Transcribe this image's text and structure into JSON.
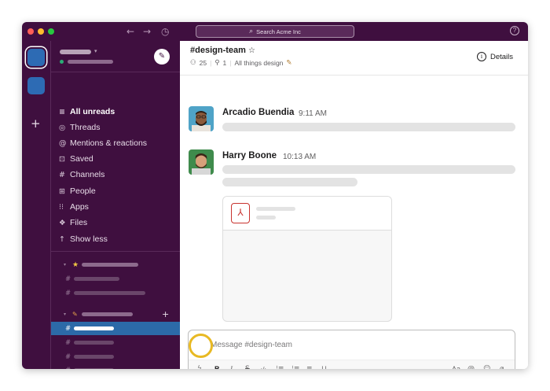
{
  "titlebar": {
    "nav_back_icon": "←",
    "nav_forward_icon": "→",
    "history_icon": "◷",
    "search_icon": "⌕",
    "search_placeholder": "Search Acme Inc",
    "help_icon": "?"
  },
  "rail": {
    "add_icon": "+"
  },
  "sidebar": {
    "compose_icon": "✎",
    "nav": [
      {
        "icon": "≡",
        "label": "All unreads"
      },
      {
        "icon": "◎",
        "label": "Threads"
      },
      {
        "icon": "@",
        "label": "Mentions & reactions"
      },
      {
        "icon": "⊡",
        "label": "Saved"
      },
      {
        "icon": "#",
        "label": "Channels"
      },
      {
        "icon": "⊞",
        "label": "People"
      },
      {
        "icon": "⁝⁝",
        "label": "Apps"
      },
      {
        "icon": "❖",
        "label": "Files"
      },
      {
        "icon": "↑",
        "label": "Show less"
      }
    ],
    "section1_icon": "★",
    "section2_icon": "✎",
    "section_add_icon": "+",
    "hash": "#",
    "arrow": "▾"
  },
  "channel": {
    "name": "#design-team",
    "star": "☆",
    "members_icon": "⚇",
    "members": "25",
    "pins_icon": "⚲",
    "pins": "1",
    "topic": "All things design",
    "topic_emoji": "✎",
    "details_icon": "i",
    "details_label": "Details"
  },
  "messages": [
    {
      "author": "Arcadio Buendia",
      "time": "9:11 AM"
    },
    {
      "author": "Harry Boone",
      "time": "10:13 AM"
    }
  ],
  "attachment": {
    "file_icon": "⅄"
  },
  "composer": {
    "placeholder": "Message #design-team",
    "tools": {
      "shortcuts": "ϟ",
      "bold": "B",
      "italic": "I",
      "strike": "S",
      "code": "‹/›",
      "ordered": "⁝≡",
      "bullet": "⁝≡",
      "indent": "≡",
      "codeblock": "⊔",
      "format": "Aa",
      "mention": "@",
      "emoji": "☺",
      "attach": "⌀"
    }
  },
  "colors": {
    "accent": "#e8b923",
    "sidebar": "#3f0f3f",
    "active": "#2c6aa8",
    "pdf": "#c8332f"
  }
}
